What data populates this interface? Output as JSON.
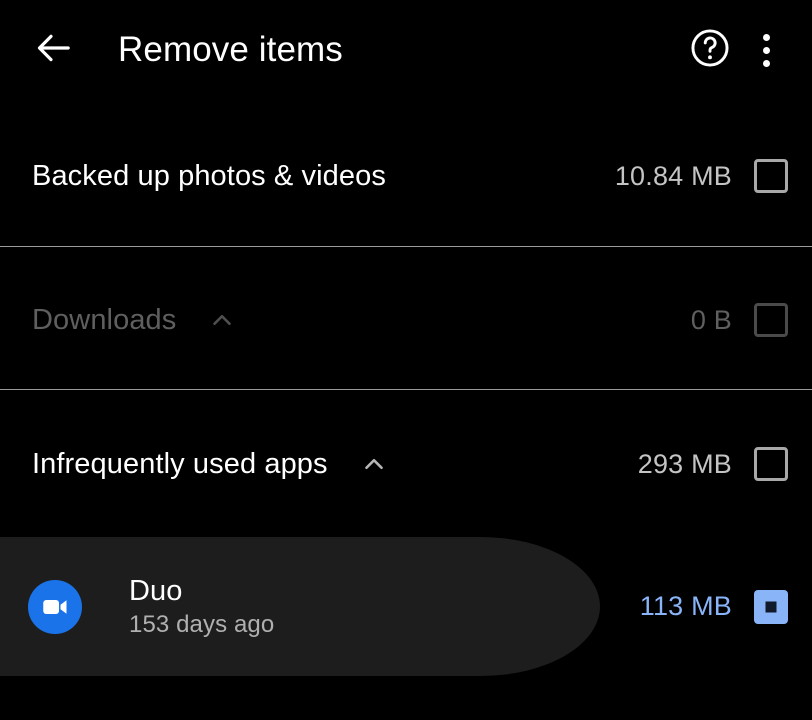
{
  "appbar": {
    "back_icon": "arrow-back-icon",
    "title": "Remove items",
    "help_icon": "help-circle-icon",
    "overflow_icon": "more-vertical-icon"
  },
  "rows": [
    {
      "id": "backed-up-photos-videos",
      "label": "Backed up photos & videos",
      "size": "10.84 MB",
      "checkbox_state": "unchecked",
      "expandable": false,
      "disabled": false
    },
    {
      "id": "downloads",
      "label": "Downloads",
      "size": "0 B",
      "checkbox_state": "unchecked",
      "expandable": true,
      "expand_icon": "chevron-up-icon",
      "disabled": true
    },
    {
      "id": "infrequently-used-apps",
      "label": "Infrequently used apps",
      "size": "293 MB",
      "checkbox_state": "unchecked",
      "expandable": true,
      "expand_icon": "chevron-up-icon",
      "disabled": false
    }
  ],
  "app_item": {
    "id": "duo",
    "icon": "duo-video-call-icon",
    "name": "Duo",
    "subtitle": "153 days ago",
    "size": "113 MB",
    "checkbox_state": "checked",
    "selected": true
  },
  "colors": {
    "background": "#000000",
    "accent_blue": "#8ab4f8",
    "app_icon_blue": "#1a73e8",
    "highlight": "#1d1d1d",
    "divider": "#9a9a9a",
    "disabled_text": "#5f5f5f"
  }
}
